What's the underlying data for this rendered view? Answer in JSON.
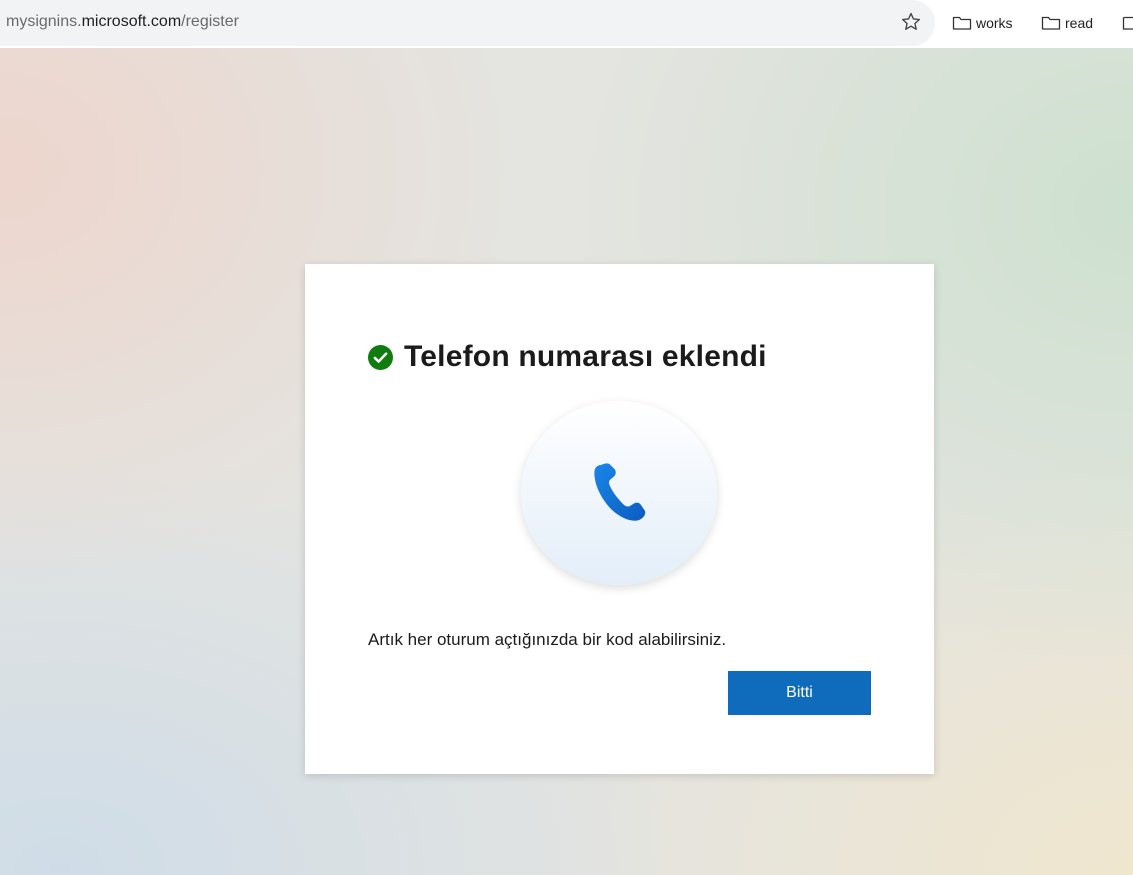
{
  "browser": {
    "url_prefix": "mysignins.",
    "url_host": "microsoft.com",
    "url_path": "/register",
    "bookmarks": [
      {
        "label": "works"
      },
      {
        "label": "read"
      }
    ]
  },
  "dialog": {
    "title": "Telefon numarası eklendi",
    "message": "Artık her oturum açtığınızda bir kod alabilirsiniz.",
    "done_label": "Bitti",
    "success_color": "#107c10",
    "accent_color": "#0f6cbd"
  },
  "icons": {
    "status": "check-circle-icon",
    "illustration": "phone-icon",
    "favorite": "star-icon",
    "bookmark": "folder-icon"
  }
}
